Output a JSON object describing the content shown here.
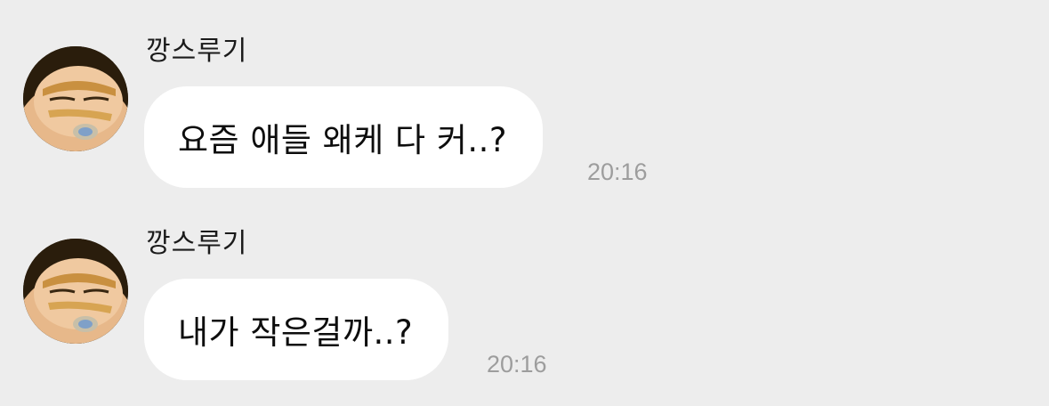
{
  "chat": {
    "messages": [
      {
        "sender": "깡스루기",
        "text": "요즘 애들 왜케 다 커..?",
        "time": "20:16",
        "avatar_icon": "cartoon-character-avatar"
      },
      {
        "sender": "깡스루기",
        "text": "내가 작은걸까..?",
        "time": "20:16",
        "avatar_icon": "cartoon-character-avatar"
      }
    ]
  },
  "colors": {
    "background": "#ededed",
    "bubble": "#ffffff",
    "timestamp": "#9d9d9d",
    "text": "#0d0d0d"
  }
}
